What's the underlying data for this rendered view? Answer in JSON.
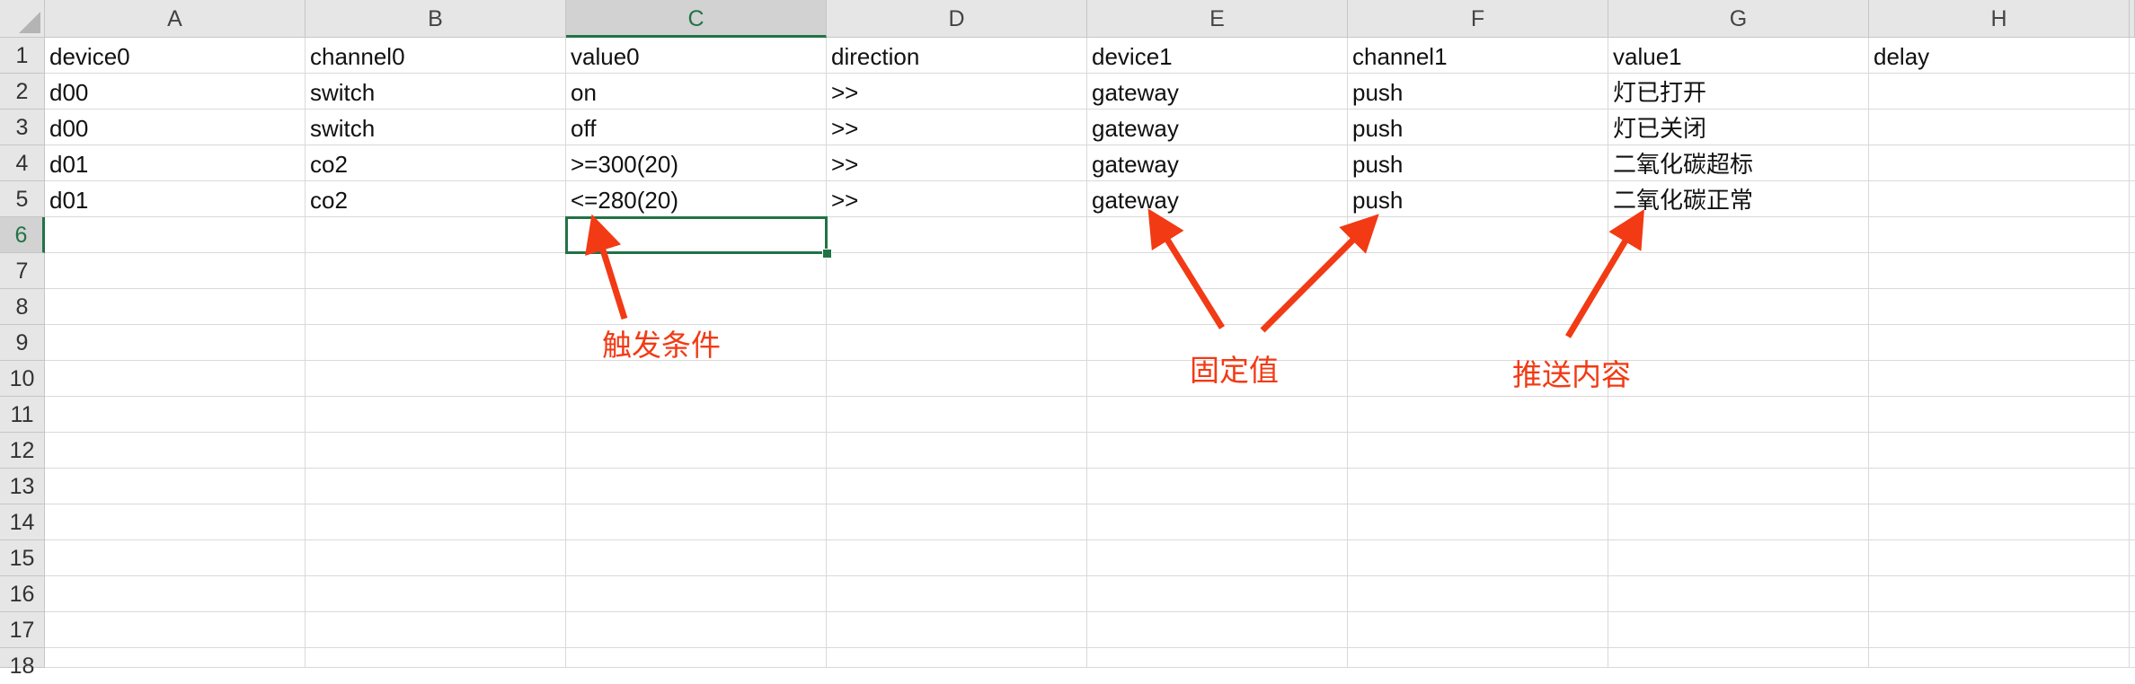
{
  "sheet": {
    "columns": [
      "A",
      "B",
      "C",
      "D",
      "E",
      "F",
      "G",
      "H"
    ],
    "rows": [
      "1",
      "2",
      "3",
      "4",
      "5",
      "6",
      "7",
      "8",
      "9",
      "10",
      "11",
      "12",
      "13",
      "14",
      "15",
      "16",
      "17",
      "18"
    ],
    "active_column": "C",
    "active_row": "6",
    "cells": [
      [
        "device0",
        "channel0",
        "value0",
        "direction",
        "device1",
        "channel1",
        "value1",
        "delay"
      ],
      [
        "d00",
        "switch",
        "on",
        ">>",
        "gateway",
        "push",
        "灯已打开",
        ""
      ],
      [
        "d00",
        "switch",
        "off",
        ">>",
        "gateway",
        "push",
        "灯已关闭",
        ""
      ],
      [
        "d01",
        "co2",
        ">=300(20)",
        ">>",
        "gateway",
        "push",
        "二氧化碳超标",
        ""
      ],
      [
        "d01",
        "co2",
        "<=280(20)",
        ">>",
        "gateway",
        "push",
        "二氧化碳正常",
        ""
      ]
    ]
  },
  "annotations": {
    "trigger": "触发条件",
    "fixed": "固定值",
    "push_content": "推送内容"
  },
  "colors": {
    "accent": "#217346",
    "annotation": "#f23a14",
    "header_bg": "#e6e6e6",
    "gridline": "#d9d9d9"
  }
}
